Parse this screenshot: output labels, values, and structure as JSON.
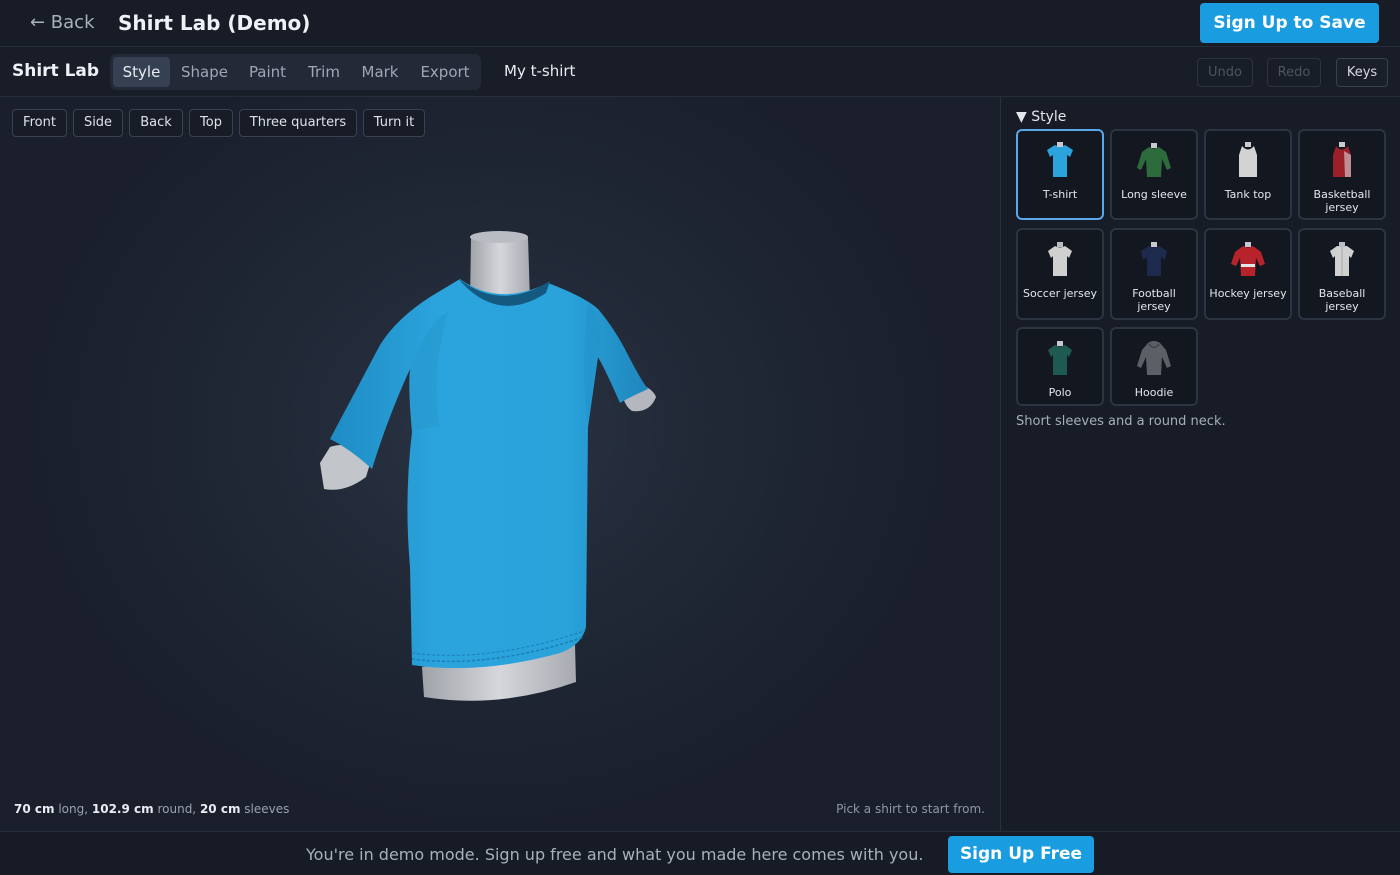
{
  "header": {
    "back_label": "← Back",
    "title": "Shirt Lab (Demo)",
    "signup_label": "Sign Up to Save"
  },
  "toolbar": {
    "brand": "Shirt Lab",
    "tabs": [
      {
        "label": "Style",
        "active": true
      },
      {
        "label": "Shape",
        "active": false
      },
      {
        "label": "Paint",
        "active": false
      },
      {
        "label": "Trim",
        "active": false
      },
      {
        "label": "Mark",
        "active": false
      },
      {
        "label": "Export",
        "active": false
      }
    ],
    "design_name": "My t-shirt",
    "undo_label": "Undo",
    "redo_label": "Redo",
    "keys_label": "Keys"
  },
  "viewport": {
    "views": [
      "Front",
      "Side",
      "Back",
      "Top",
      "Three quarters",
      "Turn it"
    ],
    "measurements": {
      "length": "70 cm",
      "length_label": "long,",
      "chest": "102.9 cm",
      "chest_label": "round,",
      "sleeve": "20 cm",
      "sleeve_label": "sleeves"
    },
    "hint": "Pick a shirt to start from.",
    "shirt_color": "#2ba4dd"
  },
  "panel": {
    "section_title": "▼ Style",
    "styles": [
      {
        "label": "T-shirt",
        "icon": "tshirt-icon",
        "color": "#2ba4dd",
        "selected": true
      },
      {
        "label": "Long sleeve",
        "icon": "long-sleeve-icon",
        "color": "#2e6b3c",
        "selected": false
      },
      {
        "label": "Tank top",
        "icon": "tank-top-icon",
        "color": "#c9c9c9",
        "selected": false
      },
      {
        "label": "Basketball jersey",
        "icon": "basketball-jersey-icon",
        "color": "#9a1f28",
        "selected": false
      },
      {
        "label": "Soccer jersey",
        "icon": "soccer-jersey-icon",
        "color": "#c9c9c9",
        "selected": false
      },
      {
        "label": "Football jersey",
        "icon": "football-jersey-icon",
        "color": "#1d2a4d",
        "selected": false
      },
      {
        "label": "Hockey jersey",
        "icon": "hockey-jersey-icon",
        "color": "#b8232b",
        "selected": false
      },
      {
        "label": "Baseball jersey",
        "icon": "baseball-jersey-icon",
        "color": "#c9c9c9",
        "selected": false
      },
      {
        "label": "Polo",
        "icon": "polo-icon",
        "color": "#1f5a52",
        "selected": false
      },
      {
        "label": "Hoodie",
        "icon": "hoodie-icon",
        "color": "#5b5f66",
        "selected": false
      }
    ],
    "description": "Short sleeves and a round neck."
  },
  "footer": {
    "message": "You're in demo mode. Sign up free and what you made here comes with you.",
    "signup_label": "Sign Up Free"
  }
}
